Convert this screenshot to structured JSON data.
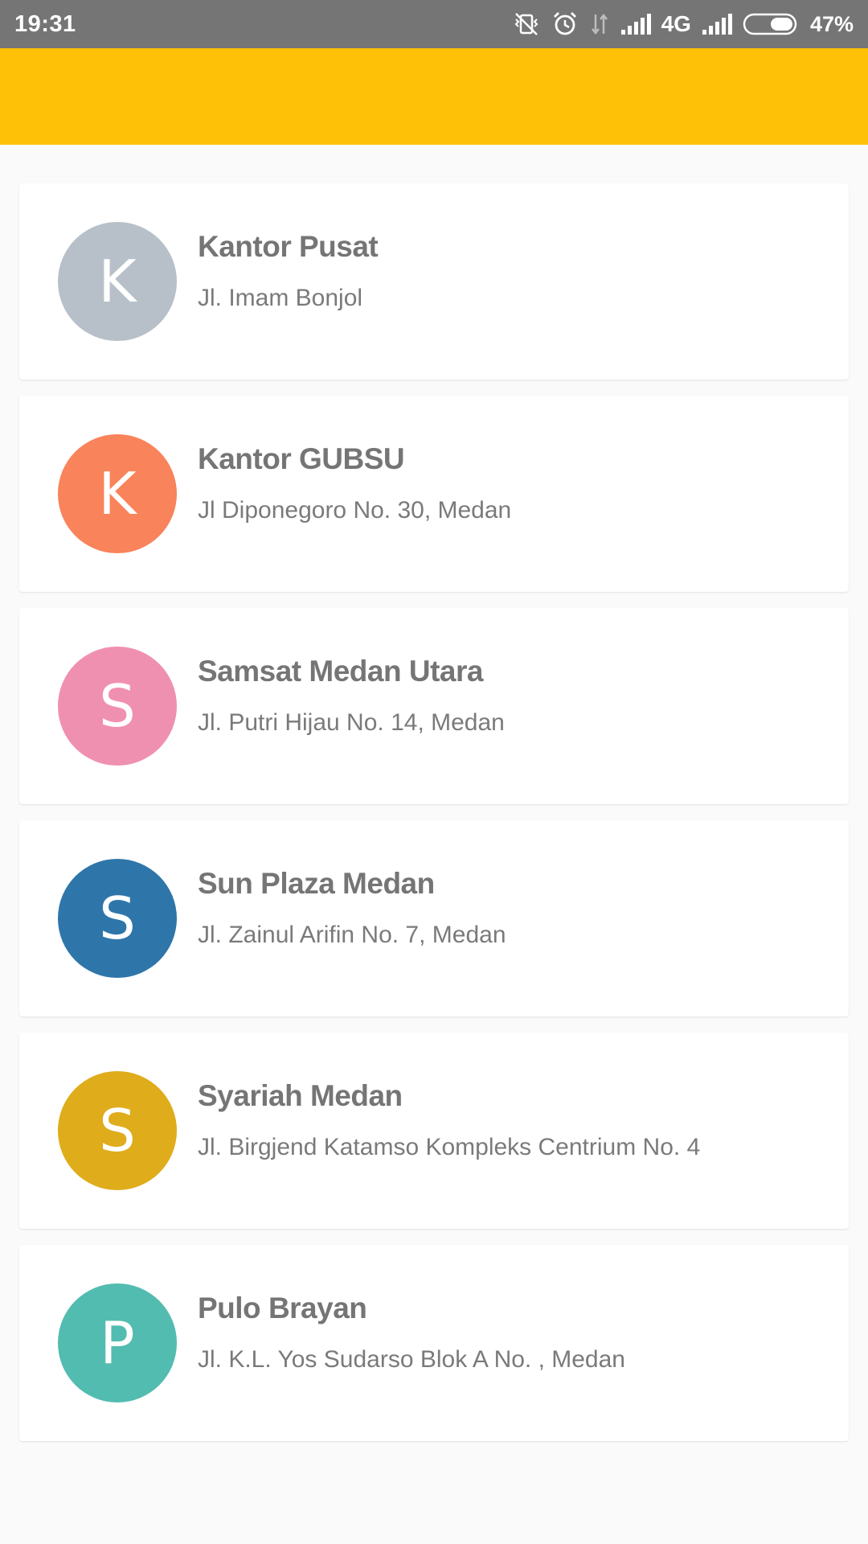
{
  "status_bar": {
    "time": "19:31",
    "network": "4G",
    "battery_pct": "47%",
    "icons": [
      "vibrate-off-icon",
      "alarm-icon",
      "data-arrows-icon",
      "signal-icon",
      "signal-2-icon",
      "battery-icon"
    ]
  },
  "app_bar": {
    "color": "#ffc107"
  },
  "locations": [
    {
      "initial": "K",
      "name": "Kantor Pusat",
      "address": "Jl. Imam Bonjol",
      "color": "#b7c0c8"
    },
    {
      "initial": "K",
      "name": "Kantor GUBSU",
      "address": "Jl Diponegoro No. 30, Medan",
      "color": "#f9835a"
    },
    {
      "initial": "S",
      "name": "Samsat Medan Utara",
      "address": "Jl. Putri Hijau No. 14, Medan",
      "color": "#f090b0"
    },
    {
      "initial": "S",
      "name": "Sun Plaza Medan",
      "address": "Jl. Zainul Arifin No. 7, Medan",
      "color": "#2e76aa"
    },
    {
      "initial": "S",
      "name": "Syariah Medan",
      "address": "Jl. Birgjend Katamso Kompleks Centrium No. 4",
      "color": "#dfac1c"
    },
    {
      "initial": "P",
      "name": "Pulo Brayan",
      "address": "Jl. K.L. Yos Sudarso Blok A No. , Medan",
      "color": "#52bcb0"
    }
  ]
}
